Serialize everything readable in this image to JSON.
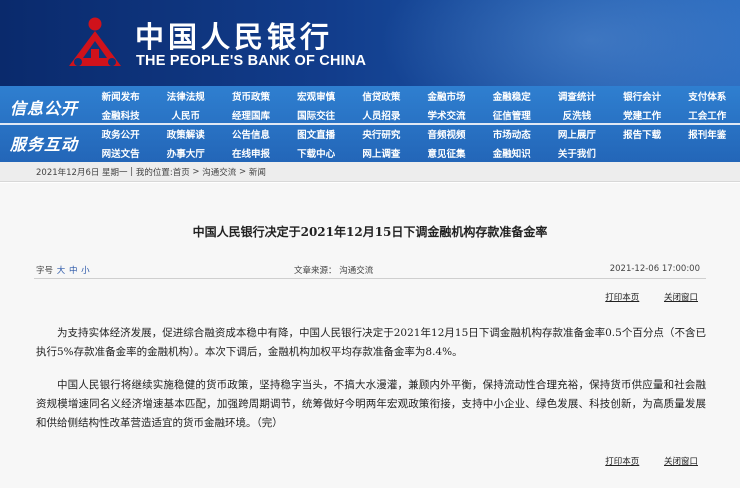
{
  "header": {
    "logo_cn": "中国人民银行",
    "logo_en": "THE PEOPLE'S BANK OF CHINA"
  },
  "nav": {
    "label_info": "信息公开",
    "label_service": "服务互动",
    "row1": [
      "新闻发布",
      "法律法规",
      "货币政策",
      "宏观审慎",
      "信贷政策",
      "金融市场",
      "金融稳定",
      "调查统计",
      "银行会计",
      "支付体系"
    ],
    "row2": [
      "金融科技",
      "人民币",
      "经理国库",
      "国际交往",
      "人员招录",
      "学术交流",
      "征信管理",
      "反洗钱",
      "党建工作",
      "工会工作"
    ],
    "row3": [
      "政务公开",
      "政策解读",
      "公告信息",
      "图文直播",
      "央行研究",
      "音频视频",
      "市场动态",
      "网上展厅",
      "报告下载",
      "报刊年鉴"
    ],
    "row4": [
      "网送文告",
      "办事大厅",
      "在线申报",
      "下载中心",
      "网上调查",
      "意见征集",
      "金融知识",
      "关于我们",
      "",
      ""
    ]
  },
  "breadcrumb": {
    "date": "2021年12月6日 星期一",
    "location_label": "我的位置:",
    "home": "首页",
    "level1": "沟通交流",
    "level2": "新闻"
  },
  "article": {
    "title": "中国人民银行决定于2021年12月15日下调金融机构存款准备金率",
    "font_size_label": "字号",
    "size_large": "大",
    "size_medium": "中",
    "size_small": "小",
    "source": "文章来源：  沟通交流",
    "datetime": "2021-12-06 17:00:00",
    "print_label": "打印本页",
    "close_label": "关闭窗口",
    "paragraphs": [
      "为支持实体经济发展，促进综合融资成本稳中有降，中国人民银行决定于2021年12月15日下调金融机构存款准备金率0.5个百分点（不含已执行5%存款准备金率的金融机构）。本次下调后，金融机构加权平均存款准备金率为8.4%。",
      "中国人民银行将继续实施稳健的货币政策，坚持稳字当头，不搞大水漫灌，兼顾内外平衡，保持流动性合理充裕，保持货币供应量和社会融资规模增速同名义经济增速基本匹配，加强跨周期调节，统筹做好今明两年宏观政策衔接，支持中小企业、绿色发展、科技创新，为高质量发展和供给侧结构性改革营造适宜的货币金融环境。（完）"
    ]
  },
  "colors": {
    "banner_dark": "#0a2a6c",
    "nav_blue": "#2f7fd0",
    "logo_red": "#d0121b"
  }
}
